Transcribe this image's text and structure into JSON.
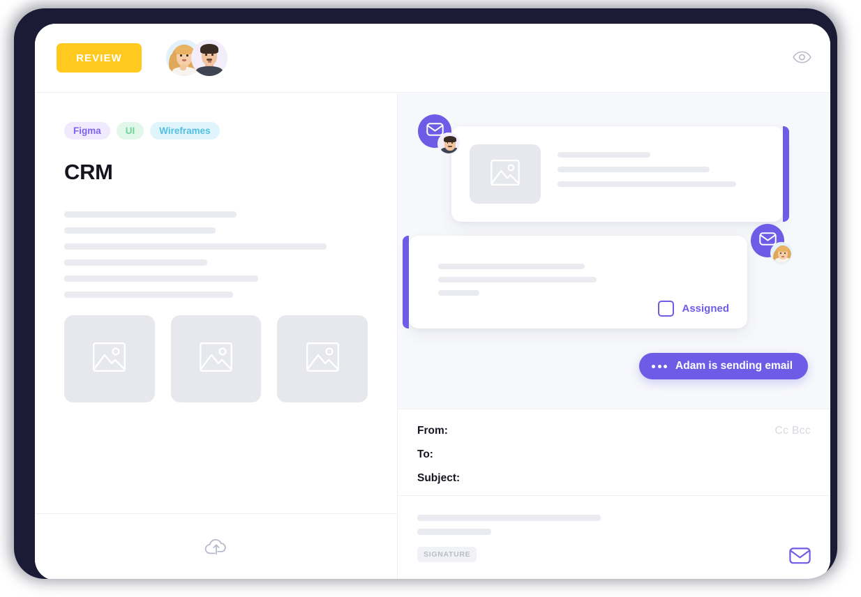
{
  "topbar": {
    "review_label": "REVIEW",
    "eye_icon": "eye-icon",
    "avatars": [
      {
        "name": "avatar-female",
        "bg": "#E3F1FA"
      },
      {
        "name": "avatar-male",
        "bg": "#F3EDFB"
      }
    ]
  },
  "left": {
    "tags": [
      {
        "label": "Figma",
        "bg": "#EFEAFD",
        "color": "#7C63E8"
      },
      {
        "label": "UI",
        "bg": "#E0F7E9",
        "color": "#72D39A"
      },
      {
        "label": "Wireframes",
        "bg": "#DFF4FB",
        "color": "#52BFE0"
      }
    ],
    "title": "CRM",
    "skeleton_widths": [
      "247px",
      "217px",
      "376px",
      "205px",
      "278px",
      "242px"
    ],
    "thumbnails": [
      {
        "name": "image-placeholder-1",
        "icon": "image-icon"
      },
      {
        "name": "image-placeholder-2",
        "icon": "image-icon"
      },
      {
        "name": "image-placeholder-3",
        "icon": "image-icon"
      }
    ],
    "upload_icon": "cloud-upload-icon"
  },
  "right": {
    "card1": {
      "badge_icon": "envelope-icon",
      "badge_color": "#6E5BE6",
      "accent_side": "right",
      "image_icon": "image-icon",
      "skeleton_widths": [
        "133px",
        "218px",
        "256px"
      ]
    },
    "card2": {
      "badge_icon": "envelope-icon",
      "badge_color": "#6E5BE6",
      "accent_side": "left",
      "skeleton_widths": [
        "210px",
        "227px",
        "59px"
      ],
      "assigned_label": "Assigned",
      "assigned_checked": false
    },
    "status_pill": {
      "text": "Adam is sending email",
      "dots": 3,
      "color": "#6E5BE6"
    },
    "compose": {
      "from_label": "From:",
      "to_label": "To:",
      "subject_label": "Subject:",
      "ccbcc_label": "Cc Bcc",
      "body_skeleton_widths": [
        "263px",
        "106px"
      ],
      "signature_label": "SIGNATURE",
      "send_icon": "envelope-icon",
      "send_icon_color": "#6E5BE6"
    }
  }
}
